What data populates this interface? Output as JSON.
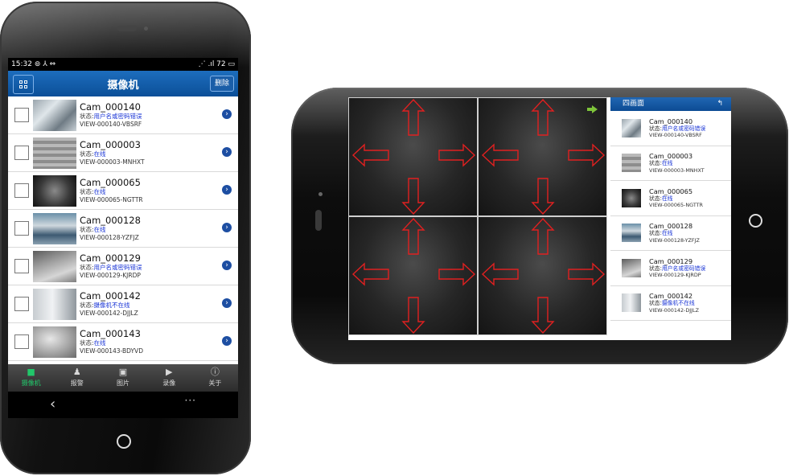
{
  "phone_portrait": {
    "status_bar": {
      "time": "15:32",
      "left_icons": "⊚ ⅄ ⇔",
      "right_icons": "⋰ .ıl 72 ▭"
    },
    "header": {
      "title": "摄像机",
      "delete_label": "删除"
    },
    "cameras": [
      {
        "name": "Cam_000140",
        "status_label": "状态:",
        "status": "用户名或密码错误",
        "view_id": "VIEW-000140-VBSRF"
      },
      {
        "name": "Cam_000003",
        "status_label": "状态:",
        "status": "在线",
        "view_id": "VIEW-000003-MNHXT"
      },
      {
        "name": "Cam_000065",
        "status_label": "状态:",
        "status": "在线",
        "view_id": "VIEW-000065-NGTTR"
      },
      {
        "name": "Cam_000128",
        "status_label": "状态:",
        "status": "在线",
        "view_id": "VIEW-000128-YZFJZ"
      },
      {
        "name": "Cam_000129",
        "status_label": "状态:",
        "status": "用户名或密码错误",
        "view_id": "VIEW-000129-KJRDP"
      },
      {
        "name": "Cam_000142",
        "status_label": "状态:",
        "status": "摄像机不在线",
        "view_id": "VIEW-000142-DJJLZ"
      },
      {
        "name": "Cam_000143",
        "status_label": "状态:",
        "status": "在线",
        "view_id": "VIEW-000143-BDYVD"
      }
    ],
    "tabs": [
      {
        "label": "摄像机",
        "icon": "camera-icon",
        "active": true
      },
      {
        "label": "报警",
        "icon": "bell-icon",
        "active": false
      },
      {
        "label": "图片",
        "icon": "picture-icon",
        "active": false
      },
      {
        "label": "录像",
        "icon": "video-icon",
        "active": false
      },
      {
        "label": "关于",
        "icon": "info-icon",
        "active": false
      }
    ],
    "nav": {
      "back": "‹",
      "menu": "···"
    }
  },
  "phone_landscape": {
    "panel_title": "四画面",
    "cameras": [
      {
        "name": "Cam_000140",
        "status_label": "状态:",
        "status": "用户名或密码错误",
        "view_id": "VIEW-000140-VBSRF"
      },
      {
        "name": "Cam_000003",
        "status_label": "状态:",
        "status": "在线",
        "view_id": "VIEW-000003-MNHXT"
      },
      {
        "name": "Cam_000065",
        "status_label": "状态:",
        "status": "在线",
        "view_id": "VIEW-000065-NGTTR"
      },
      {
        "name": "Cam_000128",
        "status_label": "状态:",
        "status": "在线",
        "view_id": "VIEW-000128-YZFJZ"
      },
      {
        "name": "Cam_000129",
        "status_label": "状态:",
        "status": "用户名或密码错误",
        "view_id": "VIEW-000129-KJRDP"
      },
      {
        "name": "Cam_000142",
        "status_label": "状态:",
        "status": "摄像机不在线",
        "view_id": "VIEW-000142-DJJLZ"
      }
    ]
  },
  "colors": {
    "accent_blue": "#0b4f98",
    "status_blue": "#1a35d6",
    "ptz_arrow": "#e02020",
    "tab_active": "#21c76a"
  }
}
